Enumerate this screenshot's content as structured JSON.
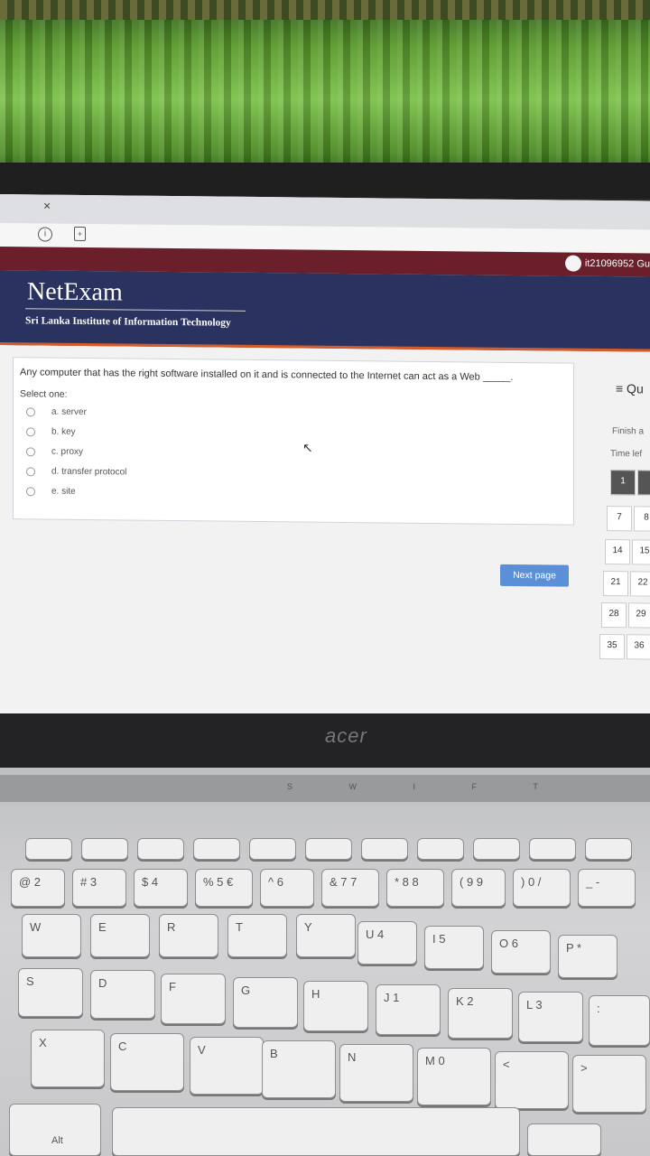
{
  "browser": {
    "tab_close": "×",
    "info_icon": "info-icon",
    "page_icon": "page-icon"
  },
  "site": {
    "user": "it21096952 Gu",
    "title": "NetExam",
    "subtitle": "Sri Lanka Institute of Information Technology"
  },
  "question": {
    "text": "Any computer that has the right software installed on it and is connected to the Internet can act as a Web _____.",
    "select_label": "Select one:",
    "options": [
      "a. server",
      "b. key",
      "c. proxy",
      "d. transfer protocol",
      "e. site"
    ],
    "next_label": "Next page"
  },
  "sidebar": {
    "title": "≡ Qu",
    "finish": "Finish a",
    "time_left": "Time lef",
    "nav_numbers": [
      "1",
      "7",
      "8",
      "14",
      "15",
      "21",
      "22",
      "28",
      "29",
      "35",
      "36"
    ]
  },
  "laptop": {
    "brand": "acer",
    "hinge_letters": "S W I F T"
  },
  "keyboard": {
    "row1": [
      "@ 2",
      "# 3",
      "$ 4",
      "% 5 €",
      "^ 6",
      "& 7 7",
      "* 8 8",
      "( 9 9",
      ") 0 /",
      "_ -"
    ],
    "row2": [
      "W",
      "E",
      "R",
      "T",
      "Y",
      "U 4",
      "I 5",
      "O 6",
      "P *"
    ],
    "row3": [
      "S",
      "D",
      "F",
      "G",
      "H",
      "J 1",
      "K 2",
      "L 3",
      ":"
    ],
    "row4": [
      "X",
      "C",
      "V",
      "B",
      "N",
      "M 0",
      "<",
      ">"
    ],
    "alt_label": "Alt"
  }
}
